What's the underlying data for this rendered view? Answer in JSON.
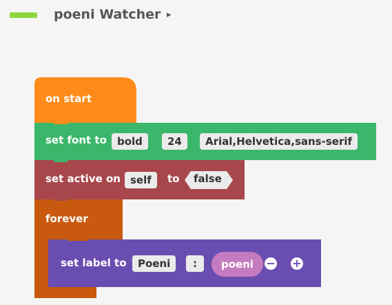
{
  "header": {
    "title": "poeni Watcher",
    "caret": "▸"
  },
  "blocks": {
    "on_start": {
      "label": "on start",
      "color": "#ff8c1a"
    },
    "set_font": {
      "label": "set font to",
      "weight": "bold",
      "size": "24",
      "family": "Arial,Helvetica,sans-serif",
      "color": "#3bb76b"
    },
    "set_active": {
      "label": "set active on",
      "target": "self",
      "to_label": "to",
      "value": "false",
      "color": "#a8474b"
    },
    "forever": {
      "label": "forever",
      "color": "#c9590f"
    },
    "set_label": {
      "label": "set label to",
      "arg1": "Poeni",
      "sep": ":",
      "arg2": "poeni",
      "minus": "−",
      "plus": "+",
      "color": "#6a4db0"
    }
  }
}
